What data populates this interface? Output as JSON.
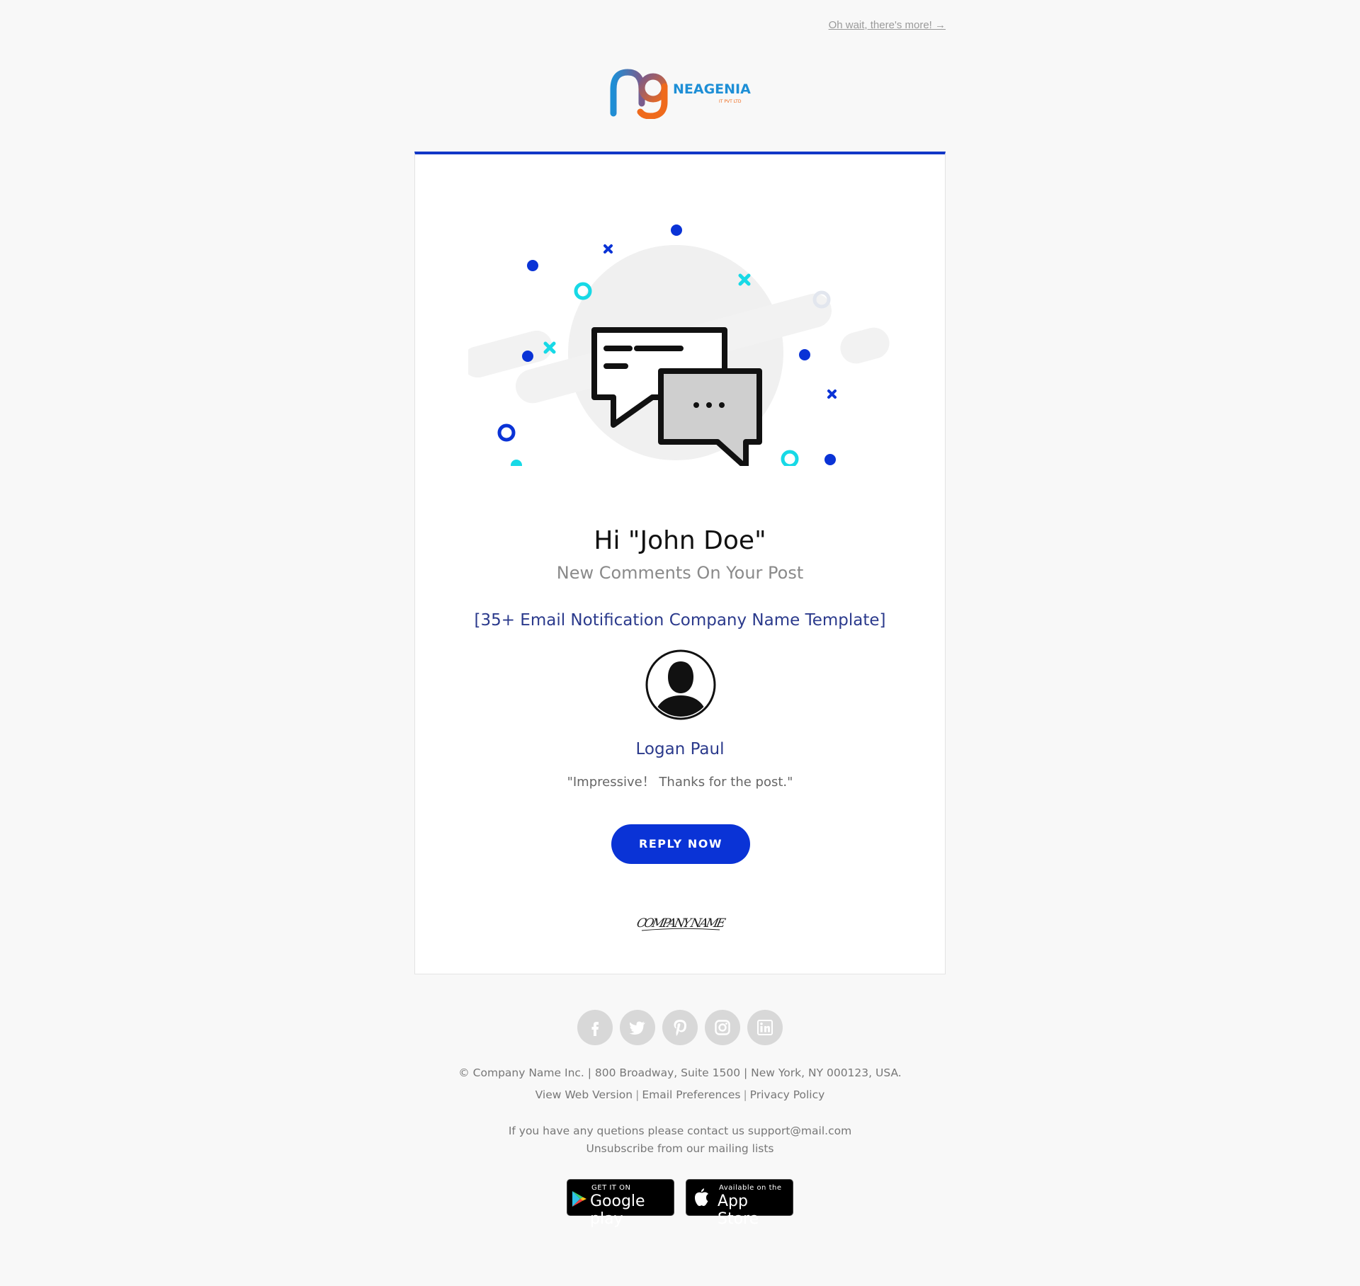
{
  "header": {
    "more_link": "Oh wait, there's more! →",
    "logo_mark": "ng",
    "logo_name": "NEAGENIA",
    "logo_sub": "IT PVT LTD"
  },
  "card": {
    "greeting": "Hi \"John Doe\"",
    "subtitle": "New Comments On Your Post",
    "post_title": "[35+ Email Notification Company Name Template]",
    "commenter_name": "Logan Paul",
    "comment_text": "\"Impressive！ Thanks for the post.\"",
    "reply_label": "REPLY NOW",
    "signature": "COMPANY NAME"
  },
  "social": [
    "facebook-icon",
    "twitter-icon",
    "pinterest-icon",
    "instagram-icon",
    "linkedin-icon"
  ],
  "footer": {
    "address": "© Company Name Inc. | 800 Broadway, Suite 1500 | New York, NY 000123, USA.",
    "links": [
      "View Web Version",
      "Email Preferences",
      "Privacy Policy"
    ],
    "contact": "If you have any quetions please contact us support@mail.com",
    "unsubscribe": "Unsubscribe from our mailing lists"
  },
  "stores": {
    "google_small": "GET IT ON",
    "google_big": "Google play",
    "apple_small": "Available on the",
    "apple_big": "App Store"
  },
  "colors": {
    "accent": "#0a33d6",
    "cyan": "#17d9e6",
    "heading_blue": "#2b3a8c",
    "background": "#f8f8f8"
  }
}
